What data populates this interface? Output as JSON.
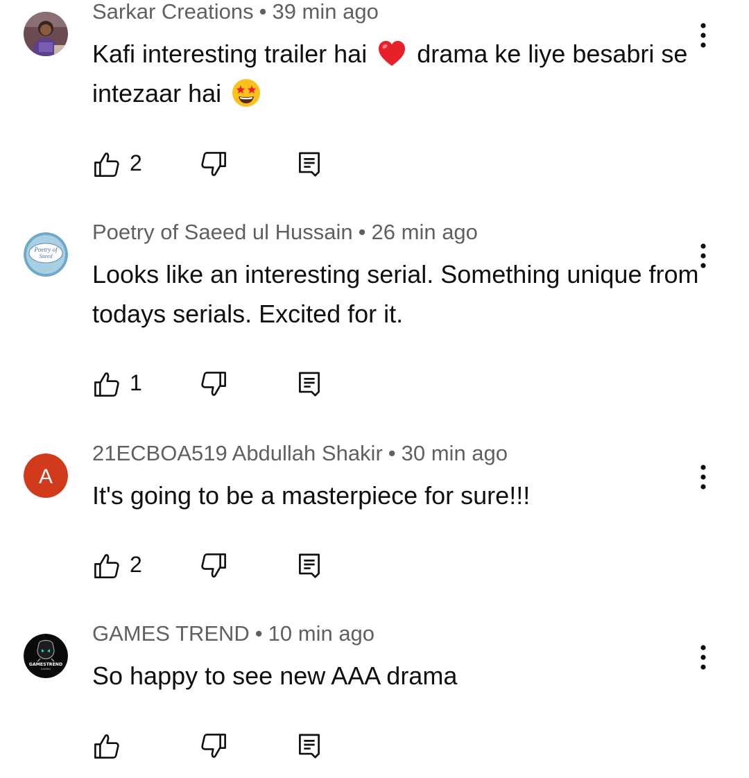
{
  "comments": [
    {
      "author": "Sarkar Creations",
      "time": "39 min ago",
      "text_before_heart": "Kafi interesting trailer hai",
      "text_after_heart": "drama ke liye besabri se intezaar hai",
      "likes": "2",
      "avatar": "photo-avatar"
    },
    {
      "author": "Poetry of Saeed ul Hussain",
      "time": "26 min ago",
      "text": "Looks like an interesting serial. Something unique from todays serials. Excited for it.",
      "likes": "1",
      "avatar_text_1": "Poetry of",
      "avatar_text_2": "Saeed"
    },
    {
      "author": "21ECBOA519 Abdullah Shakir",
      "time": "30 min ago",
      "text": "It's going to be a masterpiece for sure!!!",
      "likes": "2",
      "avatar_letter": "A",
      "avatar_color": "#d13a1a"
    },
    {
      "author": "GAMES TREND",
      "time": "10 min ago",
      "text": "So happy to see new AAA drama",
      "likes": "",
      "avatar_text_1": "GAMESTREND",
      "avatar_text_2": "GAMING"
    }
  ],
  "separator": "•",
  "icons": {
    "like": "thumbs-up-icon",
    "dislike": "thumbs-down-icon",
    "reply": "reply-comment-icon",
    "more": "more-vertical-icon"
  },
  "colors": {
    "meta": "#606060",
    "text": "#0f0f0f",
    "heart": "#e8202a",
    "emoji_face": "#fcc21b"
  }
}
